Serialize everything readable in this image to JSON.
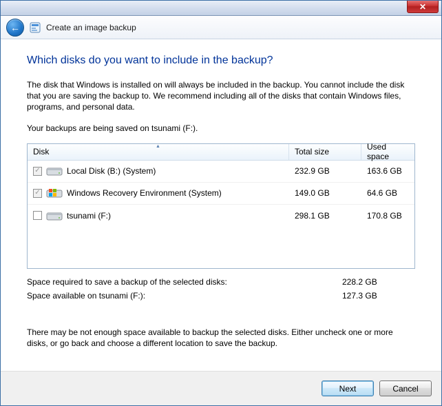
{
  "window": {
    "wizard_title": "Create an image backup"
  },
  "page": {
    "heading": "Which disks do you want to include in the backup?",
    "description": "The disk that Windows is installed on will always be included in the backup. You cannot include the disk that you are saving the backup to. We recommend including all of the disks that contain Windows files, programs, and personal data.",
    "save_location_line": "Your backups are being saved on tsunami (F:).",
    "warning": "There may be not enough space available to backup the selected disks. Either uncheck one or more disks, or go back and choose a different location to save the backup."
  },
  "table": {
    "headers": {
      "disk": "Disk",
      "total": "Total size",
      "used": "Used space"
    },
    "rows": [
      {
        "checked": true,
        "disabled": true,
        "icon": "hdd",
        "name": "Local Disk (B:) (System)",
        "total": "232.9 GB",
        "used": "163.6 GB"
      },
      {
        "checked": true,
        "disabled": true,
        "icon": "win",
        "name": "Windows Recovery Environment (System)",
        "total": "149.0 GB",
        "used": "64.6 GB"
      },
      {
        "checked": false,
        "disabled": false,
        "icon": "hdd",
        "name": "tsunami (F:)",
        "total": "298.1 GB",
        "used": "170.8 GB"
      }
    ]
  },
  "summary": {
    "required_label": "Space required to save a backup of the selected disks:",
    "required_value": "228.2 GB",
    "available_label": "Space available on tsunami (F:):",
    "available_value": "127.3 GB"
  },
  "buttons": {
    "next": "Next",
    "cancel": "Cancel"
  }
}
